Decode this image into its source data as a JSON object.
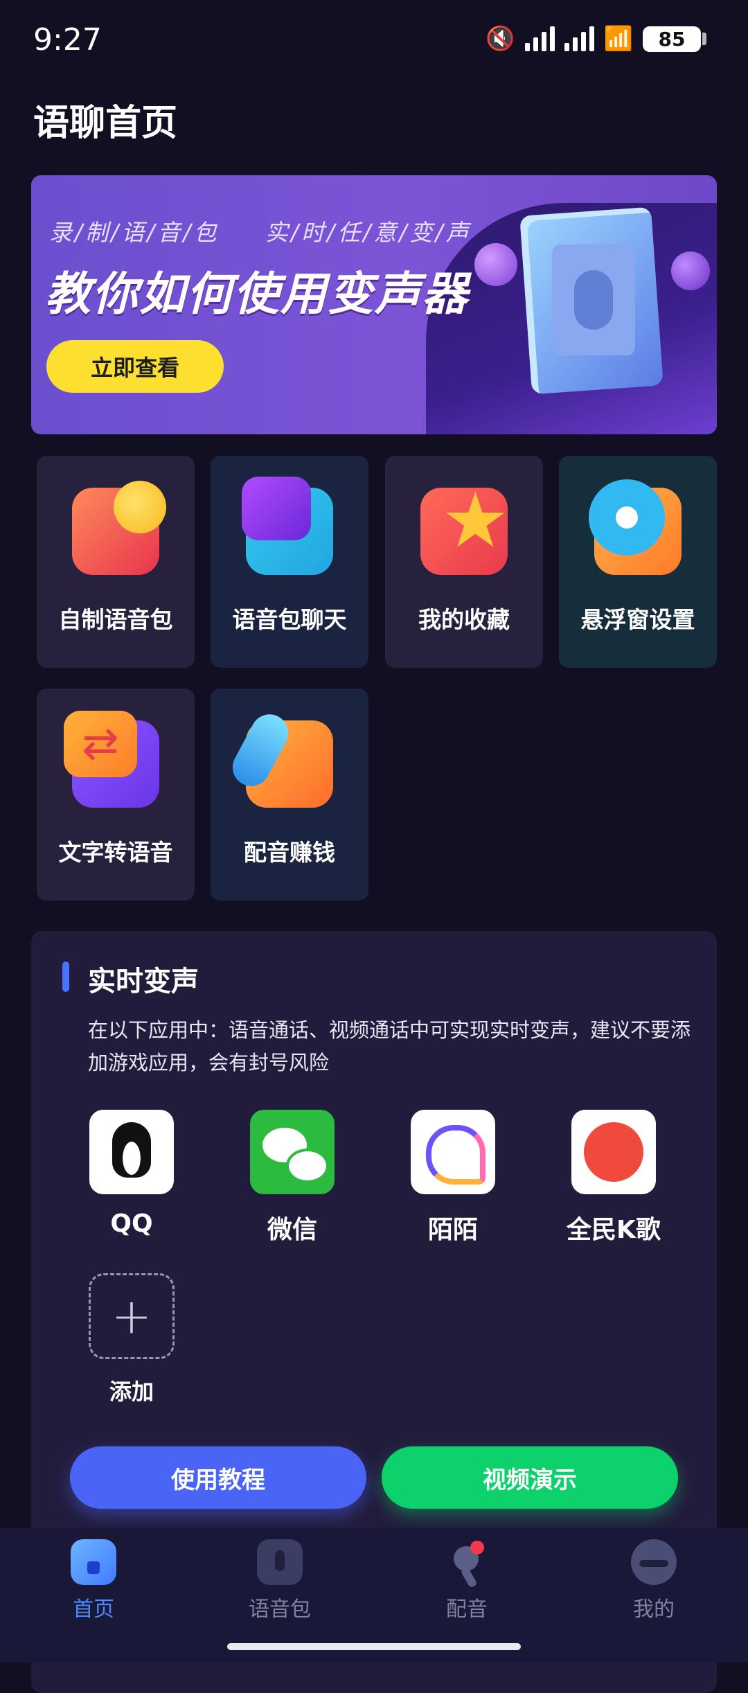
{
  "status_bar": {
    "time": "9:27",
    "battery": "85"
  },
  "page": {
    "title": "语聊首页"
  },
  "banner": {
    "subtitle_left": "录/制/语/音/包",
    "subtitle_right": "实/时/任/意/变/声",
    "headline": "教你如何使用变声器",
    "cta_label": "立即查看"
  },
  "tools": [
    {
      "label": "自制语音包",
      "icon": "mic-icon"
    },
    {
      "label": "语音包聊天",
      "icon": "voice-chat-icon"
    },
    {
      "label": "我的收藏",
      "icon": "star-icon"
    },
    {
      "label": "悬浮窗设置",
      "icon": "gear-icon"
    },
    {
      "label": "文字转语音",
      "icon": "swap-icon"
    },
    {
      "label": "配音赚钱",
      "icon": "dub-money-icon"
    }
  ],
  "realtime": {
    "title": "实时变声",
    "description": "在以下应用中：语音通话、视频通话中可实现实时变声，建议不要添加游戏应用，会有封号风险",
    "apps": [
      {
        "name": "QQ"
      },
      {
        "name": "微信"
      },
      {
        "name": "陌陌"
      },
      {
        "name": "全民K歌"
      }
    ],
    "add_label": "添加",
    "tutorial_label": "使用教程",
    "demo_label": "视频演示"
  },
  "nav": {
    "items": [
      {
        "label": "首页",
        "active": true
      },
      {
        "label": "语音包",
        "active": false
      },
      {
        "label": "配音",
        "active": false
      },
      {
        "label": "我的",
        "active": false
      }
    ]
  },
  "colors": {
    "background": "#120f22",
    "accent_blue": "#4a64f5",
    "accent_green": "#0dd16b",
    "cta_yellow": "#fde02f",
    "nav_active": "#4b8bff"
  }
}
